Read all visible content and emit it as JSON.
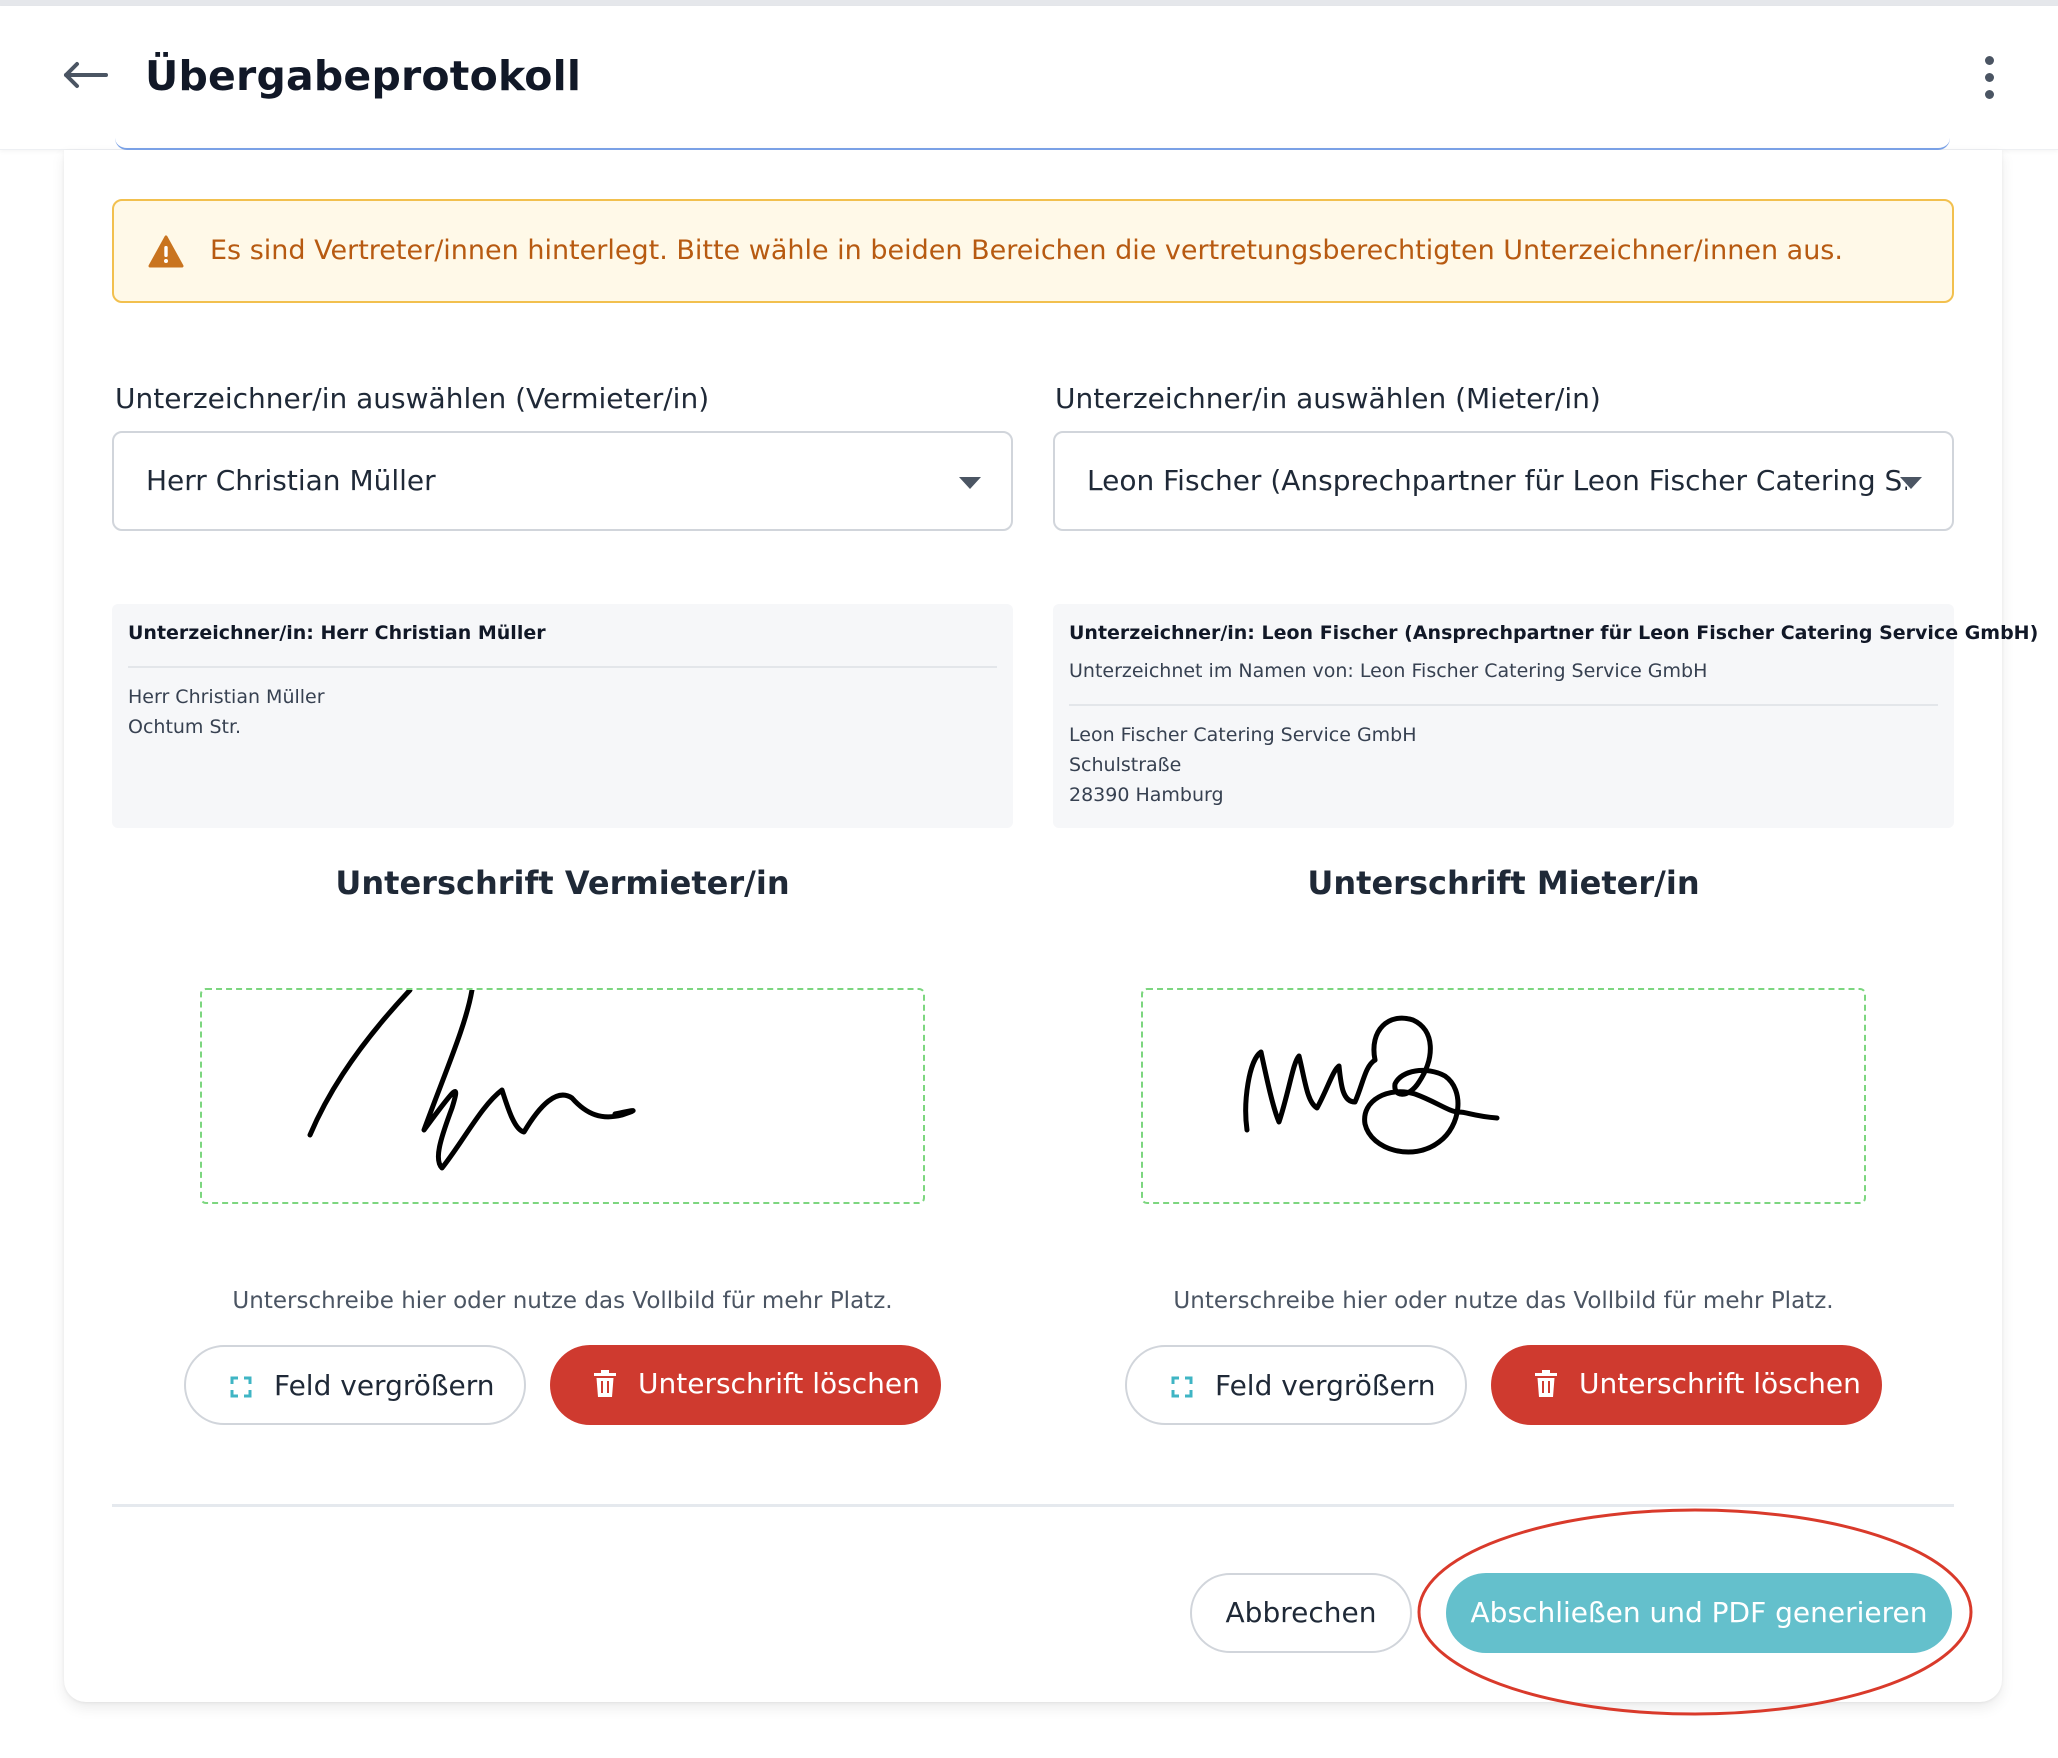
{
  "header": {
    "title": "Übergabeprotokoll"
  },
  "alert": {
    "text": "Es sind Vertreter/innen hinterlegt. Bitte wähle in beiden Bereichen die vertretungsberechtigten Unterzeichner/innen aus.",
    "color": "#b75a11"
  },
  "landlord": {
    "select_label": "Unterzeichner/in auswählen (Vermieter/in)",
    "selected_value": "Herr Christian Müller",
    "info_heading": "Unterzeichner/in: Herr Christian Müller",
    "info_lines": [
      "Herr Christian Müller",
      "Ochtum Str."
    ],
    "signature_title": "Unterschrift Vermieter/in",
    "signature_hint": "Unterschreibe hier oder nutze das Vollbild für mehr Platz.",
    "enlarge_label": "Feld vergrößern",
    "clear_label": "Unterschrift löschen"
  },
  "tenant": {
    "select_label": "Unterzeichner/in auswählen (Mieter/in)",
    "selected_value": "Leon Fischer (Ansprechpartner für Leon Fischer Catering S...",
    "info_heading": "Unterzeichner/in: Leon Fischer (Ansprechpartner für Leon Fischer Catering Service GmbH)",
    "info_subheading": "Unterzeichnet im Namen von: Leon Fischer Catering Service GmbH",
    "info_lines": [
      "Leon Fischer Catering Service GmbH",
      "Schulstraße",
      "28390 Hamburg"
    ],
    "signature_title": "Unterschrift Mieter/in",
    "signature_hint": "Unterschreibe hier oder nutze das Vollbild für mehr Platz.",
    "enlarge_label": "Feld vergrößern",
    "clear_label": "Unterschrift löschen"
  },
  "footer": {
    "cancel_label": "Abbrechen",
    "submit_label": "Abschließen und PDF generieren"
  },
  "colors": {
    "primary": "#64c0cc",
    "danger": "#cf3a2f",
    "warning_border": "#f2c04e",
    "warning_bg": "#fff9e8",
    "pad_border": "#7cd67f",
    "highlight_ring": "#d93a2b"
  },
  "icons": [
    "arrow-left-icon",
    "more-vertical-icon",
    "warning-icon",
    "chevron-down-icon",
    "expand-icon",
    "trash-icon"
  ]
}
